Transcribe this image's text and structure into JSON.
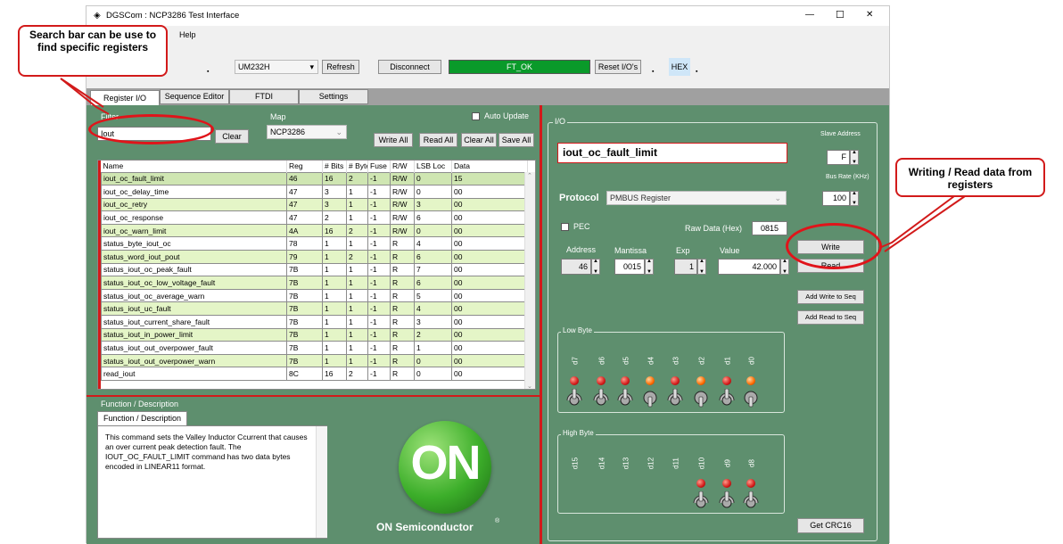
{
  "window": {
    "title": "DGSCom : NCP3286 Test Interface",
    "minimize": "—",
    "maximize": "☐",
    "close": "✕"
  },
  "menu": {
    "help": "Help"
  },
  "toolbar": {
    "device": "UM232H",
    "refresh": "Refresh",
    "disconnect": "Disconnect",
    "status": "FT_OK",
    "reset": "Reset I/O's",
    "hex": "HEX"
  },
  "tabs": [
    "Register I/O",
    "Sequence Editor",
    "FTDI",
    "Settings"
  ],
  "filter": {
    "label": "Filter",
    "value": "Iout",
    "clear": "Clear"
  },
  "map": {
    "label": "Map",
    "value": "NCP3286"
  },
  "auto_update": "Auto Update",
  "actions": {
    "write_all": "Write All",
    "read_all": "Read All",
    "clear_all": "Clear All",
    "save_all": "Save All"
  },
  "table": {
    "headers": [
      "Name",
      "Reg",
      "# Bits",
      "# Byte",
      "Fuse I",
      "R/W",
      "LSB Loc",
      "Data"
    ],
    "rows": [
      [
        "iout_oc_fault_limit",
        "46",
        "16",
        "2",
        "-1",
        "R/W",
        "0",
        "15"
      ],
      [
        "iout_oc_delay_time",
        "47",
        "3",
        "1",
        "-1",
        "R/W",
        "0",
        "00"
      ],
      [
        "iout_oc_retry",
        "47",
        "3",
        "1",
        "-1",
        "R/W",
        "3",
        "00"
      ],
      [
        "iout_oc_response",
        "47",
        "2",
        "1",
        "-1",
        "R/W",
        "6",
        "00"
      ],
      [
        "iout_oc_warn_limit",
        "4A",
        "16",
        "2",
        "-1",
        "R/W",
        "0",
        "00"
      ],
      [
        "status_byte_iout_oc",
        "78",
        "1",
        "1",
        "-1",
        "R",
        "4",
        "00"
      ],
      [
        "status_word_iout_pout",
        "79",
        "1",
        "2",
        "-1",
        "R",
        "6",
        "00"
      ],
      [
        "status_iout_oc_peak_fault",
        "7B",
        "1",
        "1",
        "-1",
        "R",
        "7",
        "00"
      ],
      [
        "status_iout_oc_low_voltage_fault",
        "7B",
        "1",
        "1",
        "-1",
        "R",
        "6",
        "00"
      ],
      [
        "status_iout_oc_average_warn",
        "7B",
        "1",
        "1",
        "-1",
        "R",
        "5",
        "00"
      ],
      [
        "status_iout_uc_fault",
        "7B",
        "1",
        "1",
        "-1",
        "R",
        "4",
        "00"
      ],
      [
        "status_iout_current_share_fault",
        "7B",
        "1",
        "1",
        "-1",
        "R",
        "3",
        "00"
      ],
      [
        "status_iout_in_power_limit",
        "7B",
        "1",
        "1",
        "-1",
        "R",
        "2",
        "00"
      ],
      [
        "status_iout_out_overpower_fault",
        "7B",
        "1",
        "1",
        "-1",
        "R",
        "1",
        "00"
      ],
      [
        "status_iout_out_overpower_warn",
        "7B",
        "1",
        "1",
        "-1",
        "R",
        "0",
        "00"
      ],
      [
        "read_iout",
        "8C",
        "16",
        "2",
        "-1",
        "R",
        "0",
        "00"
      ]
    ]
  },
  "description": {
    "header": "Function / Description",
    "tab": "Function / Description",
    "text": "This command sets the Valley Inductor Ccurrent that causes an over current peak detection fault. The IOUT_OC_FAULT_LIMIT command has two data bytes encoded in LINEAR11 format."
  },
  "logo": {
    "mark": "ON",
    "company": "ON Semiconductor",
    "reg": "®"
  },
  "io": {
    "group": "I/O",
    "register_name": "iout_oc_fault_limit",
    "slave_label": "Slave Address",
    "slave_value": "F",
    "bus_label": "Bus Rate (KHz)",
    "bus_value": "100",
    "protocol_label": "Protocol",
    "protocol_value": "PMBUS Register",
    "pec": "PEC",
    "raw_label": "Raw Data (Hex)",
    "raw_value": "0815",
    "address_label": "Address",
    "address_value": "46",
    "mantissa_label": "Mantissa",
    "mantissa_value": "0015",
    "exp_label": "Exp",
    "exp_value": "1",
    "value_label": "Value",
    "value_value": "42.000",
    "write": "Write",
    "read": "Read",
    "add_write": "Add Write to Seq",
    "add_read": "Add Read to Seq",
    "low_byte": "Low Byte",
    "high_byte": "High Byte",
    "crc": "Get CRC16",
    "low_bits": [
      "d7",
      "d6",
      "d5",
      "d4",
      "d3",
      "d2",
      "d1",
      "d0"
    ],
    "low_states": [
      0,
      0,
      0,
      1,
      0,
      1,
      0,
      1
    ],
    "high_bits": [
      "d15",
      "d14",
      "d13",
      "d12",
      "d11",
      "d10",
      "d9",
      "d8"
    ]
  },
  "callouts": {
    "search": "Search bar can be use to find specific registers",
    "rw": "Writing / Read data from registers"
  },
  "colors": {
    "panel_green": "#5e8f6e",
    "status_green": "#0a9a2a",
    "accent_red": "#d21a1a",
    "row_green": "#e4f5c7"
  }
}
